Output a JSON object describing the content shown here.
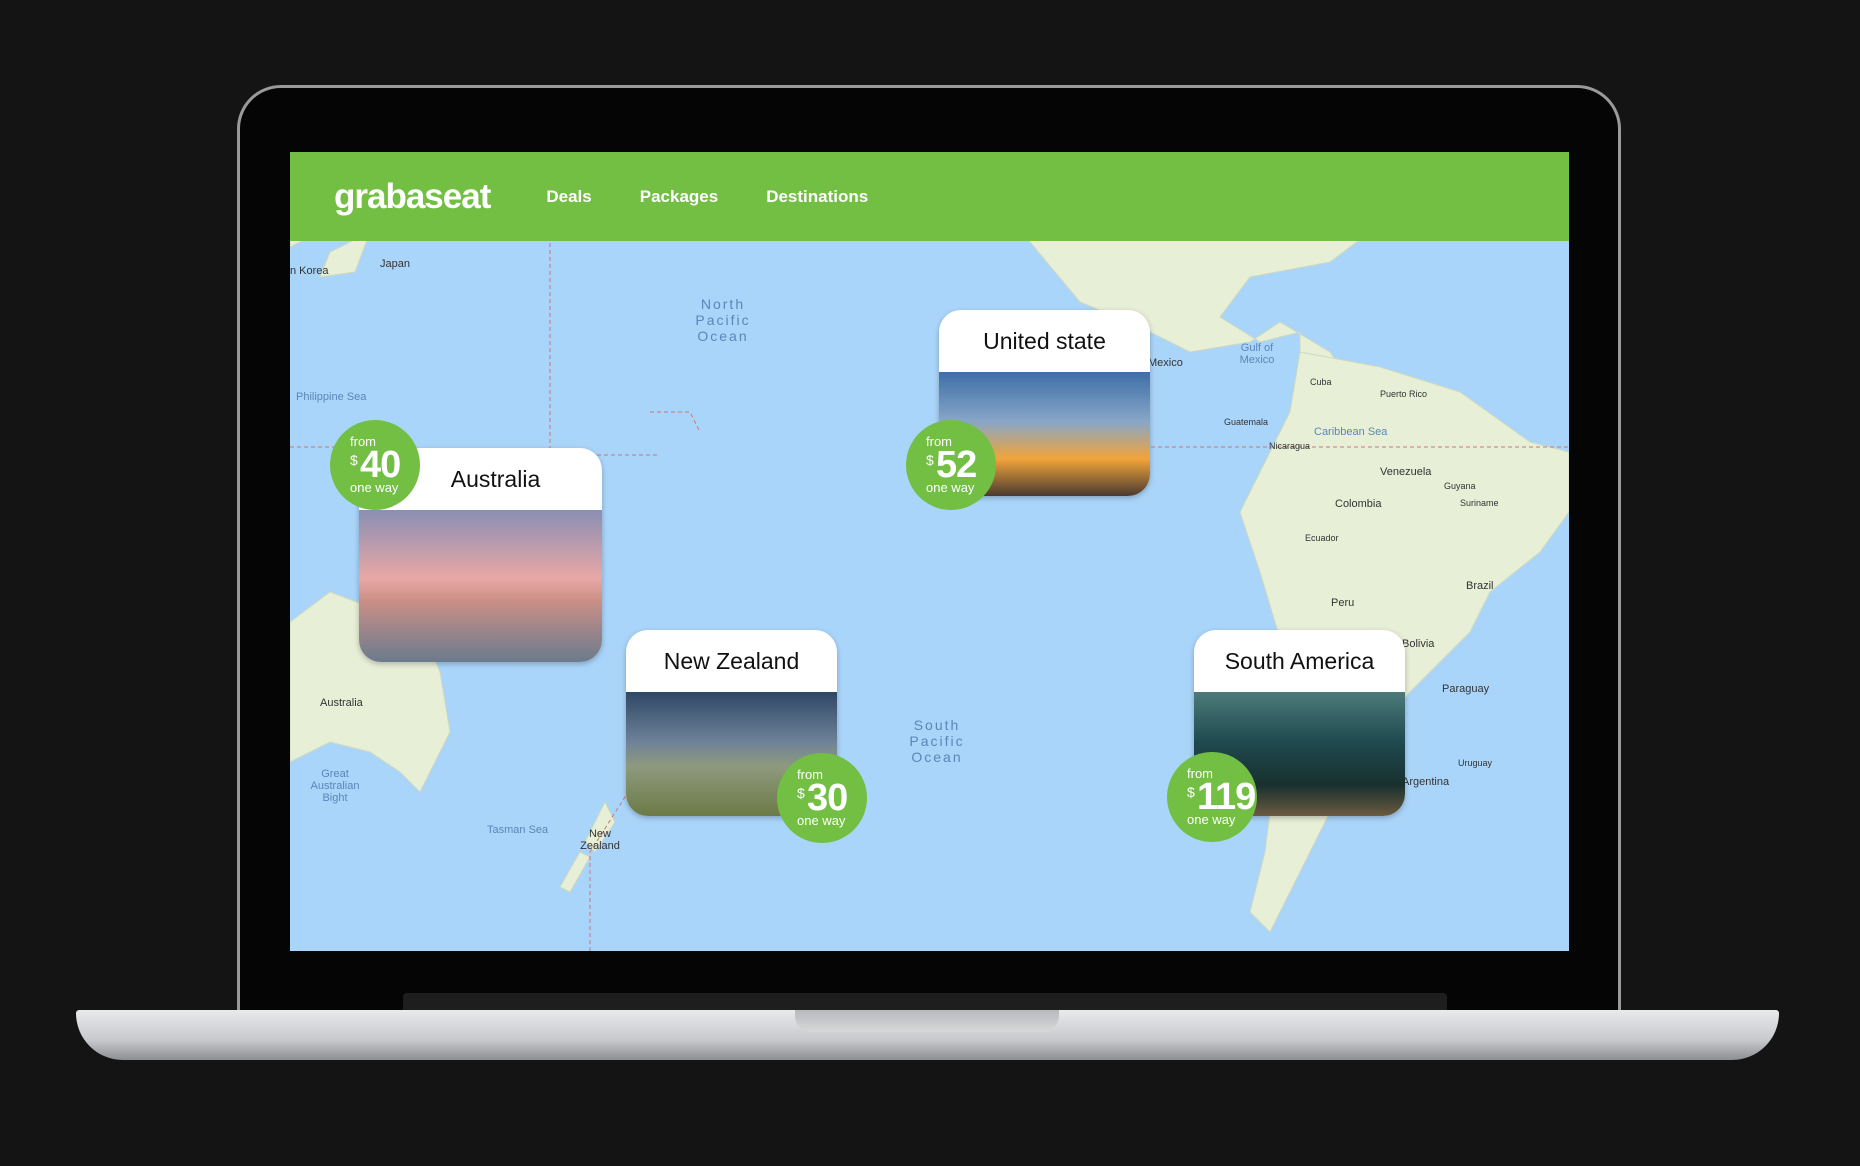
{
  "header": {
    "logo": "grabaseat",
    "nav": [
      "Deals",
      "Packages",
      "Destinations"
    ]
  },
  "colors": {
    "brand": "#72bf44",
    "ocean": "#aad5fa",
    "land": "#e7efd6"
  },
  "map_labels": {
    "countries": [
      "Japan",
      "n Korea",
      "Australia",
      "Mexico",
      "Cuba",
      "Puerto Rico",
      "Venezuela",
      "Colombia",
      "Peru",
      "Brazil",
      "Bolivia",
      "Paraguay",
      "Argentina",
      "Uruguay",
      "Guatemala",
      "Nicaragua",
      "Ecuador",
      "New Zealand",
      "Guyana",
      "Suriname"
    ],
    "seas": [
      "Philippine Sea",
      "Tasman Sea",
      "Gulf of Mexico",
      "Caribbean Sea",
      "Great Australian Bight"
    ],
    "oceans": [
      "North Pacific Ocean",
      "South Pacific Ocean"
    ]
  },
  "destinations": [
    {
      "name": "Australia",
      "from": "from",
      "currency": "$",
      "price": "40",
      "unit": "one way"
    },
    {
      "name": "United state",
      "from": "from",
      "currency": "$",
      "price": "52",
      "unit": "one way"
    },
    {
      "name": "New Zealand",
      "from": "from",
      "currency": "$",
      "price": "30",
      "unit": "one way"
    },
    {
      "name": "South America",
      "from": "from",
      "currency": "$",
      "price": "119",
      "unit": "one way"
    }
  ]
}
